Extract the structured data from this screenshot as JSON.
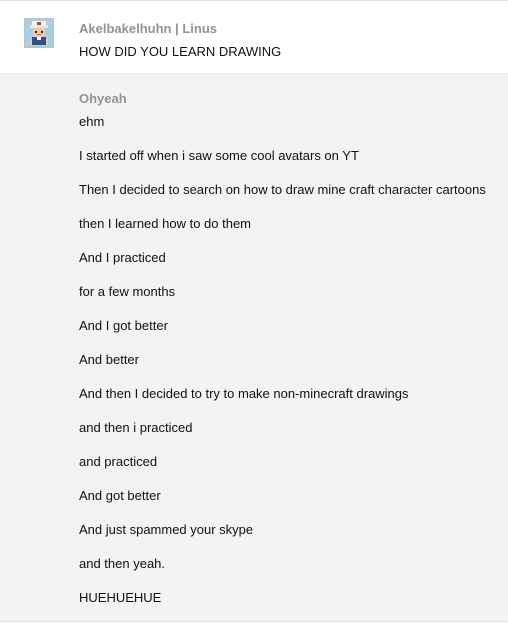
{
  "messages": [
    {
      "sender": "Akelbakelhuhn | Linus",
      "avatar_icon": "pixel-character-avatar-icon",
      "lines": [
        "HOW DID YOU LEARN DRAWING"
      ]
    },
    {
      "sender": "Ohyeah",
      "lines": [
        "ehm",
        "I started off when i saw some cool avatars on YT",
        "Then I decided to search on how to draw mine craft character cartoons",
        "then I learned how to do them",
        "And I practiced",
        "for a few months",
        "And I got better",
        "And better",
        "And then I decided to try to make non-minecraft drawings",
        "and then i practiced",
        "and practiced",
        "And got better",
        "And just spammed your skype",
        "and then yeah.",
        "HUEHUEHUE"
      ]
    }
  ],
  "colors": {
    "sender": "#8c959c",
    "text": "#111111",
    "group_highlight": "#f3f3f3"
  }
}
